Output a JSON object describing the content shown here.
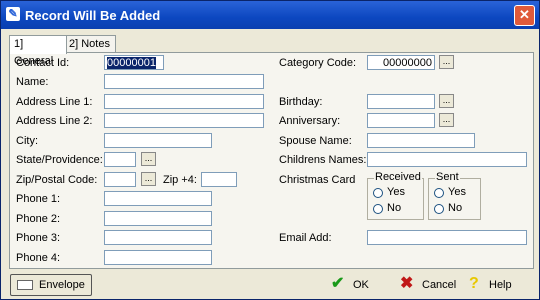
{
  "window": {
    "title": "Record Will Be Added",
    "close_glyph": "✕"
  },
  "tabs": [
    {
      "label": "1] General"
    },
    {
      "label": "2] Notes"
    }
  ],
  "left": {
    "contact_id_label": "Contact Id:",
    "contact_id_value": "00000001",
    "name_label": "Name:",
    "address1_label": "Address Line 1:",
    "address2_label": "Address Line 2:",
    "city_label": "City:",
    "state_label": "State/Providence:",
    "zip_label": "Zip/Postal Code:",
    "zip4_label": "Zip +4:",
    "phone1_label": "Phone 1:",
    "phone2_label": "Phone 2:",
    "phone3_label": "Phone 3:",
    "phone4_label": "Phone 4:"
  },
  "right": {
    "category_label": "Category Code:",
    "category_value": "00000000",
    "birthday_label": "Birthday:",
    "anniversary_label": "Anniversary:",
    "spouse_label": "Spouse Name:",
    "children_label": "Childrens Names:",
    "christmas_label": "Christmas Card",
    "received_label": "Received",
    "sent_label": "Sent",
    "yes_label": "Yes",
    "no_label": "No",
    "email_label": "Email Add:"
  },
  "lookup_glyph": "...",
  "buttons": {
    "envelope": "Envelope",
    "ok": "OK",
    "cancel": "Cancel",
    "help": "Help"
  },
  "colors": {
    "titlebar": "#0c47c0",
    "selection": "#0a246a",
    "ok_check": "#1a9a1a",
    "cancel_x": "#c01818",
    "help_q": "#e8c800"
  }
}
